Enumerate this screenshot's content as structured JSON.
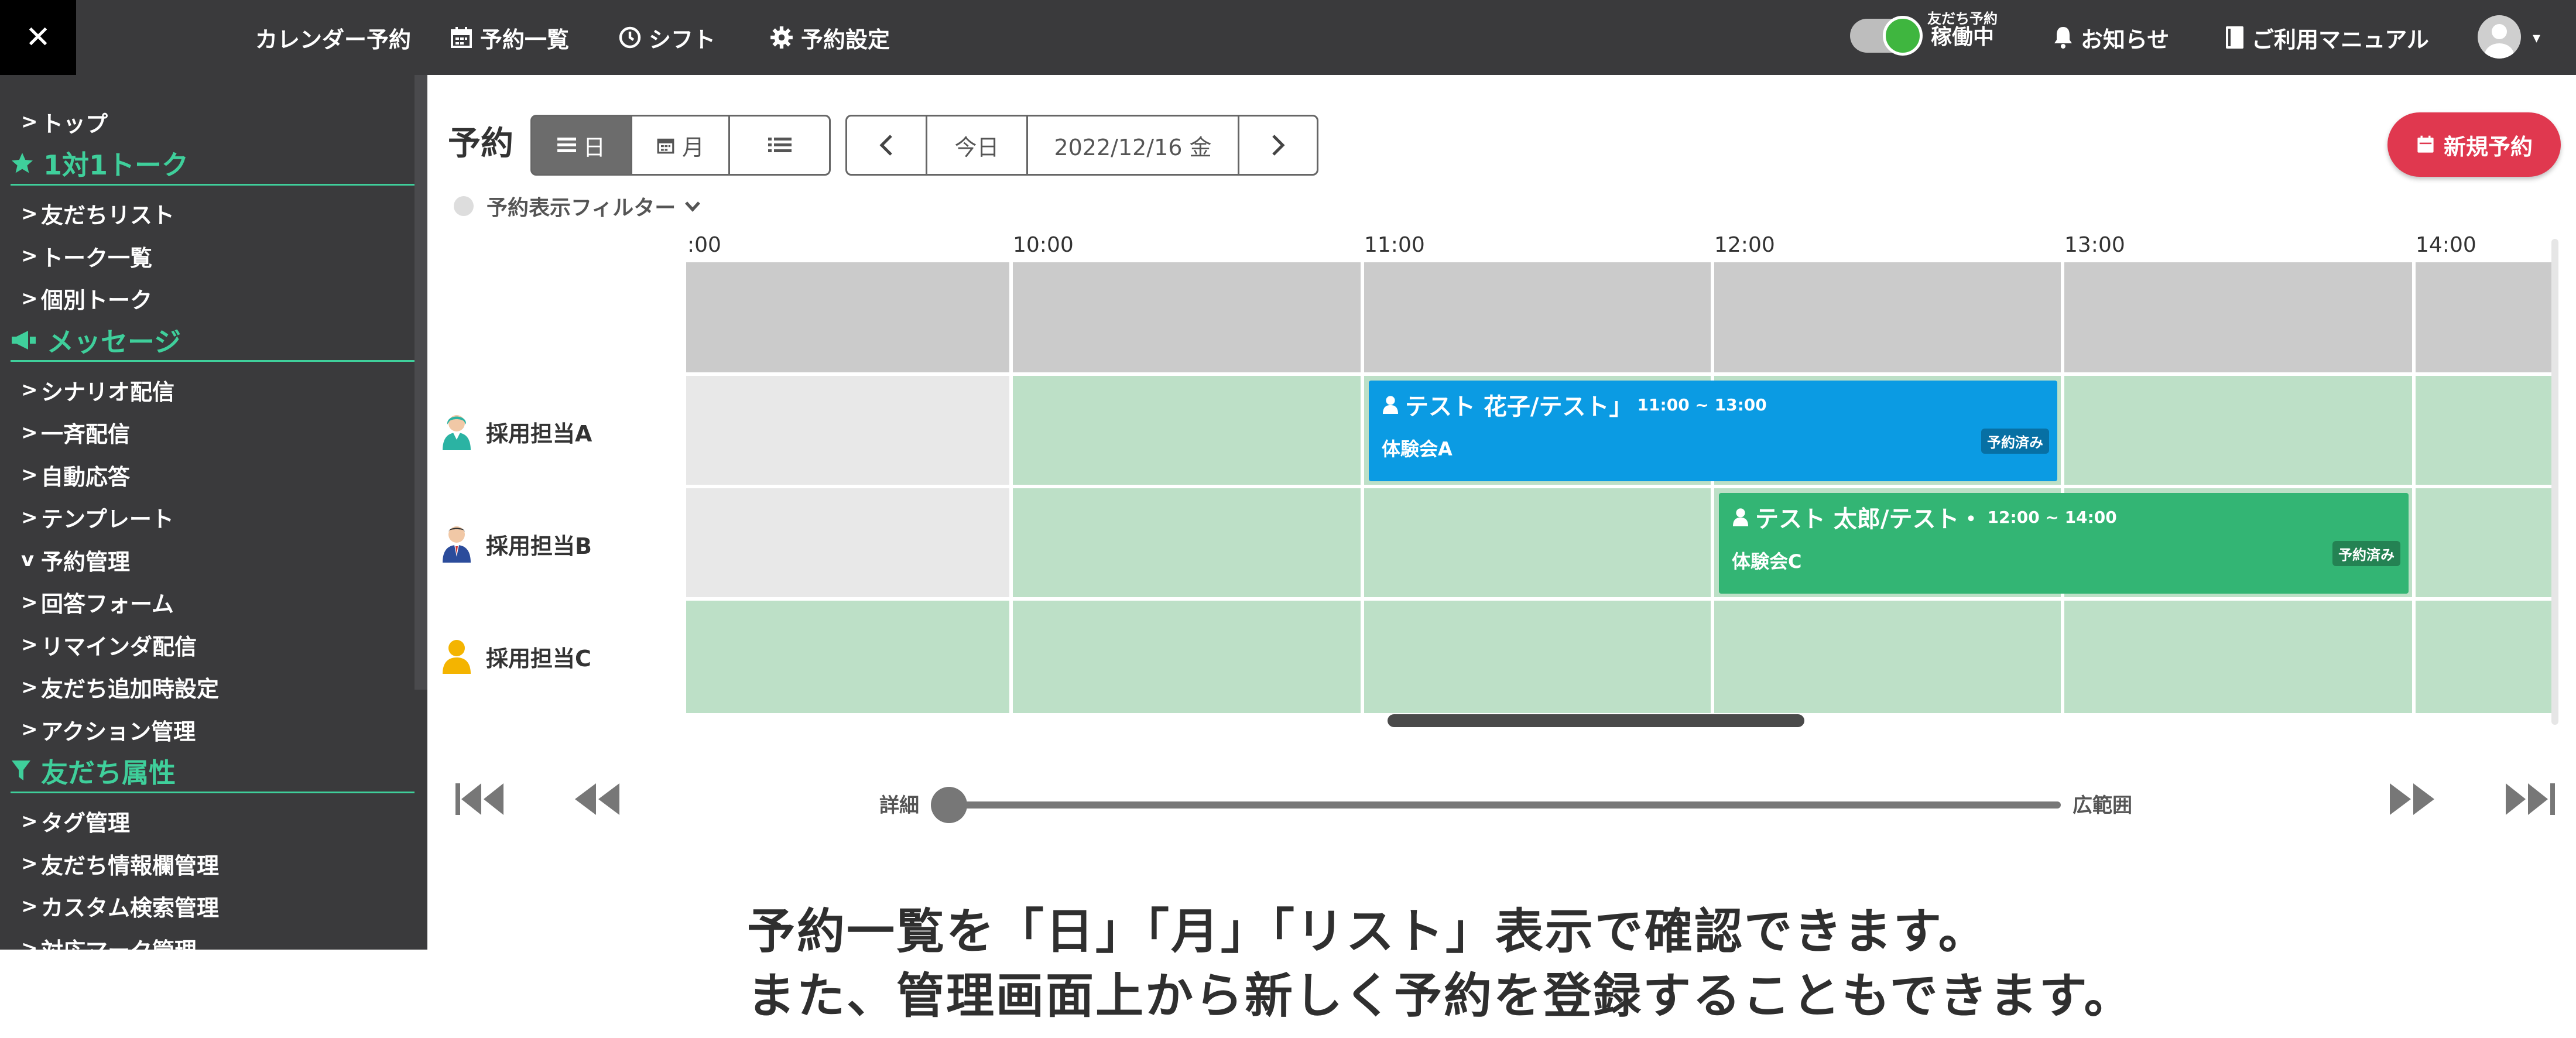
{
  "topbar": {
    "close_symbol": "✕",
    "nav": [
      {
        "label": "カレンダー予約"
      },
      {
        "label": "予約一覧",
        "icon": "calendar-icon"
      },
      {
        "label": "シフト",
        "icon": "clock-icon"
      },
      {
        "label": "予約設定",
        "icon": "gear-icon"
      }
    ],
    "toggle_caption": "友だち予約",
    "toggle_status": "稼働中",
    "notifications": "お知らせ",
    "manual": "ご利用マニュアル",
    "avatar_caret": "▾"
  },
  "sidebar": {
    "items": [
      {
        "type": "item",
        "label": "トップ",
        "arrow": ">"
      },
      {
        "type": "section",
        "label": "1対1トーク",
        "icon": "star-icon"
      },
      {
        "type": "item",
        "label": "友だちリスト",
        "arrow": ">"
      },
      {
        "type": "item",
        "label": "トーク一覧",
        "arrow": ">"
      },
      {
        "type": "item",
        "label": "個別トーク",
        "arrow": ">"
      },
      {
        "type": "section",
        "label": "メッセージ",
        "icon": "megaphone-icon"
      },
      {
        "type": "item",
        "label": "シナリオ配信",
        "arrow": ">"
      },
      {
        "type": "item",
        "label": "一斉配信",
        "arrow": ">"
      },
      {
        "type": "item",
        "label": "自動応答",
        "arrow": ">"
      },
      {
        "type": "item",
        "label": "テンプレート",
        "arrow": ">"
      },
      {
        "type": "item",
        "label": "予約管理",
        "arrow": "v"
      },
      {
        "type": "item",
        "label": "回答フォーム",
        "arrow": ">"
      },
      {
        "type": "item",
        "label": "リマインダ配信",
        "arrow": ">"
      },
      {
        "type": "item",
        "label": "友だち追加時設定",
        "arrow": ">"
      },
      {
        "type": "item",
        "label": "アクション管理",
        "arrow": ">"
      },
      {
        "type": "section",
        "label": "友だち属性",
        "icon": "filter-icon"
      },
      {
        "type": "item",
        "label": "タグ管理",
        "arrow": ">"
      },
      {
        "type": "item",
        "label": "友だち情報欄管理",
        "arrow": ">"
      },
      {
        "type": "item",
        "label": "カスタム検索管理",
        "arrow": ">"
      },
      {
        "type": "item",
        "label": "対応マーク管理",
        "arrow": ">"
      }
    ]
  },
  "header": {
    "title": "予約",
    "view_day": "日",
    "view_month": "月",
    "today": "今日",
    "date": "2022/12/16 金",
    "new_booking": "新規予約",
    "filter": "予約表示フィルター"
  },
  "timeline": {
    "times": [
      ":00",
      "10:00",
      "11:00",
      "12:00",
      "13:00",
      "14:00"
    ],
    "resources": [
      {
        "name": "採用担当A",
        "icon": "staff-woman-icon",
        "color": "#2bb3a3"
      },
      {
        "name": "採用担当B",
        "icon": "staff-man-icon",
        "color": "#2b4c9b"
      },
      {
        "name": "採用担当C",
        "icon": "person-icon",
        "color": "#f4b400"
      }
    ],
    "bookings": [
      {
        "title": "テスト 花子/テスト」",
        "time": "11:00 ~ 13:00",
        "place": "体験会A",
        "badge": "予約済み",
        "color": "#0b9be3",
        "resource": 0,
        "start": "11:00",
        "end": "13:00"
      },
      {
        "title": "テスト 太郎/テスト・",
        "time": "12:00 ~ 14:00",
        "place": "体験会C",
        "badge": "予約済み",
        "color": "#33b574",
        "resource": 1,
        "start": "12:00",
        "end": "14:00"
      }
    ],
    "colors": {
      "unavailable": "#cbcbcb",
      "past": "#e8e8e8",
      "available": "#bde0c7"
    }
  },
  "zoom": {
    "min_label": "詳細",
    "max_label": "広範囲",
    "level": 0
  },
  "caption": {
    "line1": "予約一覧を「日」「月」「リスト」表示で確認できます。",
    "line2": "また、管理画面上から新しく予約を登録することもできます。"
  }
}
